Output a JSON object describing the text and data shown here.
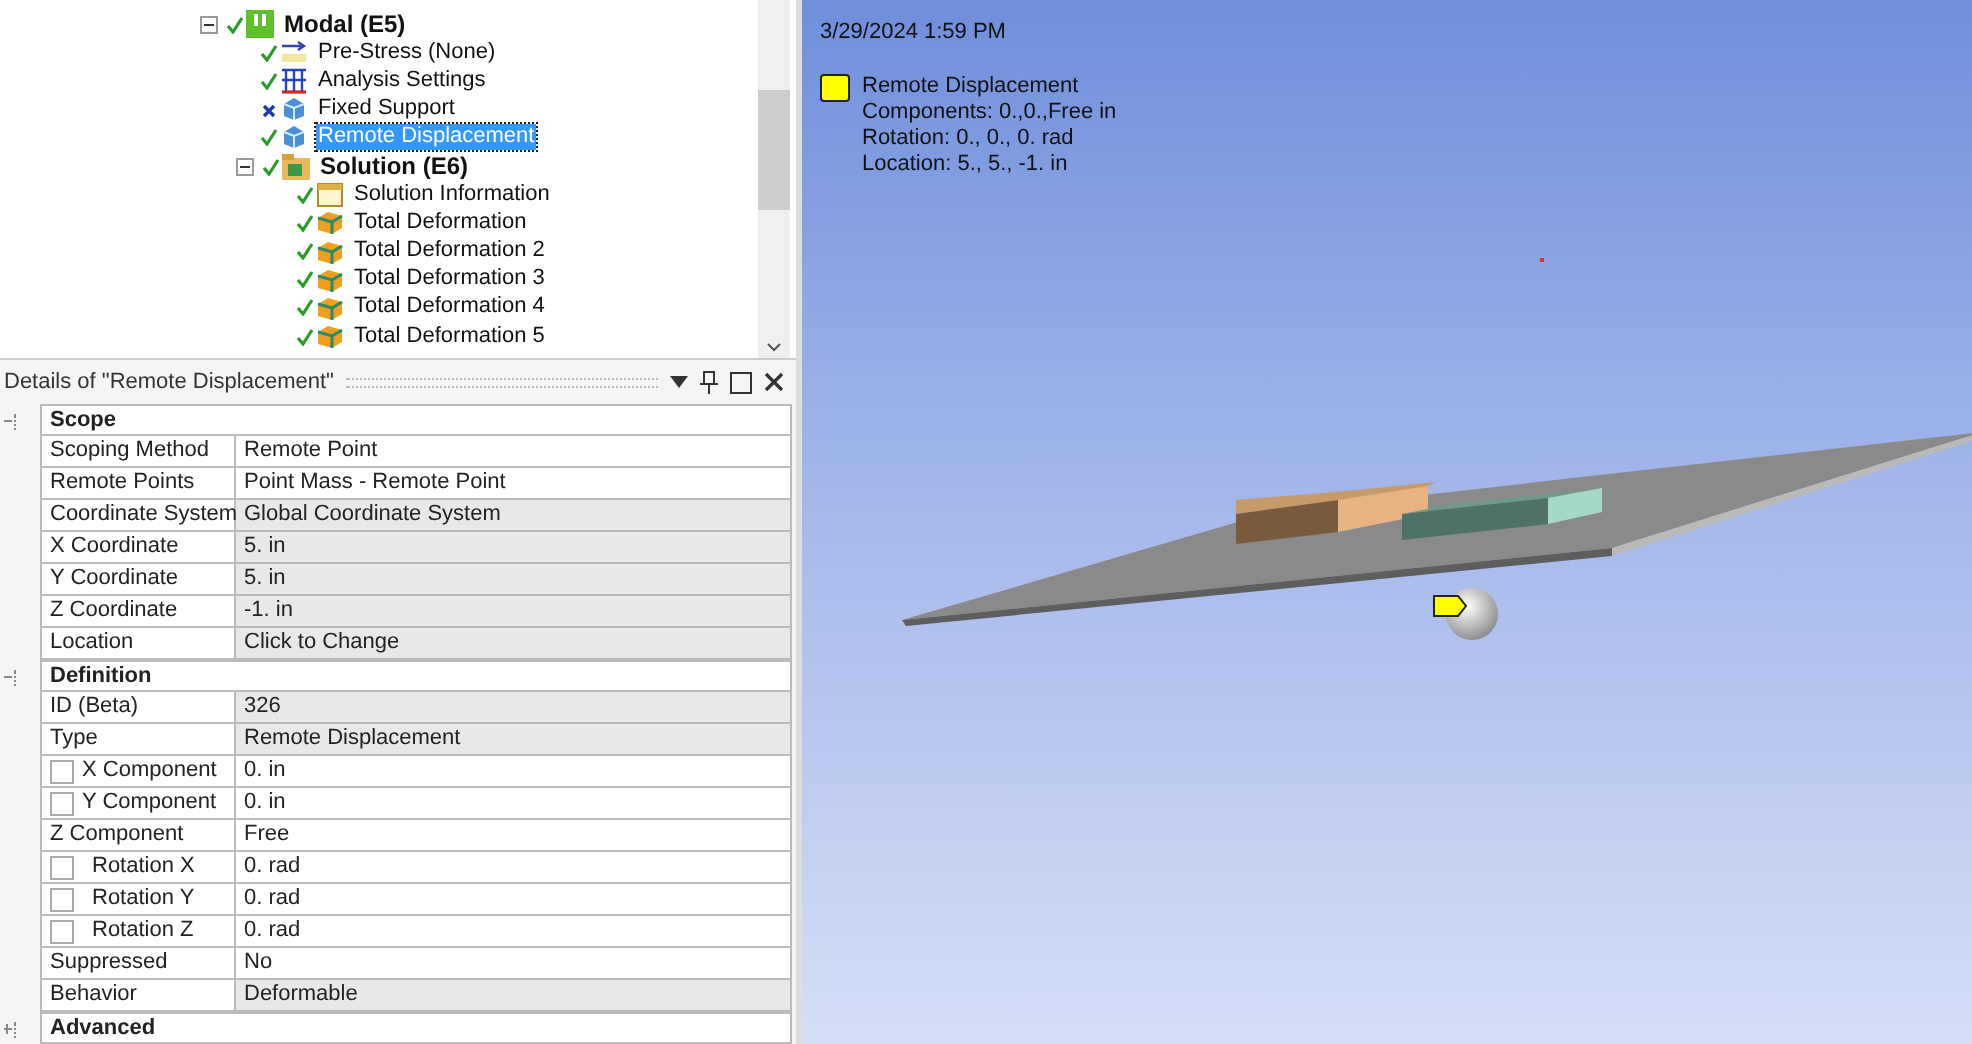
{
  "tree": [
    {
      "label": "Modal (E5)",
      "failed": false,
      "kind": "analysis",
      "expanded": true,
      "selected": false,
      "children": [
        {
          "label": "Pre-Stress (None)",
          "failed": false,
          "kind": "prestress",
          "selected": false
        },
        {
          "label": "Analysis Settings",
          "failed": false,
          "kind": "settings",
          "selected": false
        },
        {
          "label": "Fixed Support",
          "failed": true,
          "kind": "support",
          "selected": false
        },
        {
          "label": "Remote Displacement",
          "failed": false,
          "kind": "support",
          "selected": true
        },
        {
          "label": "Solution (E6)",
          "failed": false,
          "kind": "solution",
          "expanded": true,
          "selected": false,
          "children": [
            {
              "label": "Solution Information",
              "failed": false,
              "kind": "info",
              "selected": false
            },
            {
              "label": "Total Deformation",
              "failed": false,
              "kind": "result",
              "selected": false
            },
            {
              "label": "Total Deformation 2",
              "failed": false,
              "kind": "result",
              "selected": false
            },
            {
              "label": "Total Deformation 3",
              "failed": false,
              "kind": "result",
              "selected": false
            },
            {
              "label": "Total Deformation 4",
              "failed": false,
              "kind": "result",
              "selected": false
            },
            {
              "label": "Total Deformation 5",
              "failed": false,
              "kind": "result",
              "selected": false
            }
          ]
        }
      ]
    }
  ],
  "details": {
    "title": "Details of \"Remote Displacement\"",
    "sections": [
      {
        "title": "Scope",
        "expanded": true,
        "rows": [
          {
            "kind": "plain",
            "name": "Scoping Method",
            "value": "Remote Point",
            "readonly": false
          },
          {
            "kind": "plain",
            "name": "Remote Points",
            "value": "Point Mass - Remote Point",
            "readonly": false
          },
          {
            "kind": "plain",
            "name": "Coordinate System",
            "value": "Global Coordinate System",
            "readonly": true
          },
          {
            "kind": "plain",
            "name": "X Coordinate",
            "value": "5. in",
            "readonly": true
          },
          {
            "kind": "plain",
            "name": "Y Coordinate",
            "value": "5. in",
            "readonly": true
          },
          {
            "kind": "plain",
            "name": "Z Coordinate",
            "value": "-1. in",
            "readonly": true
          },
          {
            "kind": "plain",
            "name": "Location",
            "value": "Click to Change",
            "readonly": true
          }
        ]
      },
      {
        "title": "Definition",
        "expanded": true,
        "rows": [
          {
            "kind": "plain",
            "name": "ID (Beta)",
            "value": "326",
            "readonly": true
          },
          {
            "kind": "plain",
            "name": "Type",
            "value": "Remote Displacement",
            "readonly": true
          },
          {
            "kind": "check",
            "name": "X Component",
            "value": "0. in",
            "readonly": false,
            "checked": false
          },
          {
            "kind": "check",
            "name": "Y Component",
            "value": "0. in",
            "readonly": false,
            "checked": false
          },
          {
            "kind": "plain",
            "name": "Z Component",
            "value": "Free",
            "readonly": false
          },
          {
            "kind": "check",
            "name": "Rotation X",
            "value": "0. rad",
            "readonly": false,
            "checked": false
          },
          {
            "kind": "check",
            "name": "Rotation Y",
            "value": "0. rad",
            "readonly": false,
            "checked": false
          },
          {
            "kind": "check",
            "name": "Rotation Z",
            "value": "0. rad",
            "readonly": false,
            "checked": false
          },
          {
            "kind": "plain",
            "name": "Suppressed",
            "value": "No",
            "readonly": false
          },
          {
            "kind": "plain",
            "name": "Behavior",
            "value": "Deformable",
            "readonly": true
          }
        ]
      },
      {
        "title": "Advanced",
        "expanded": false
      }
    ]
  },
  "viewport": {
    "date": "3/29/2024 1:59 PM",
    "legend": {
      "title": "Remote Displacement",
      "lines": [
        "Components: 0.,0.,Free in",
        "Rotation: 0., 0., 0. rad",
        "Location: 5., 5., -1. in"
      ]
    }
  }
}
